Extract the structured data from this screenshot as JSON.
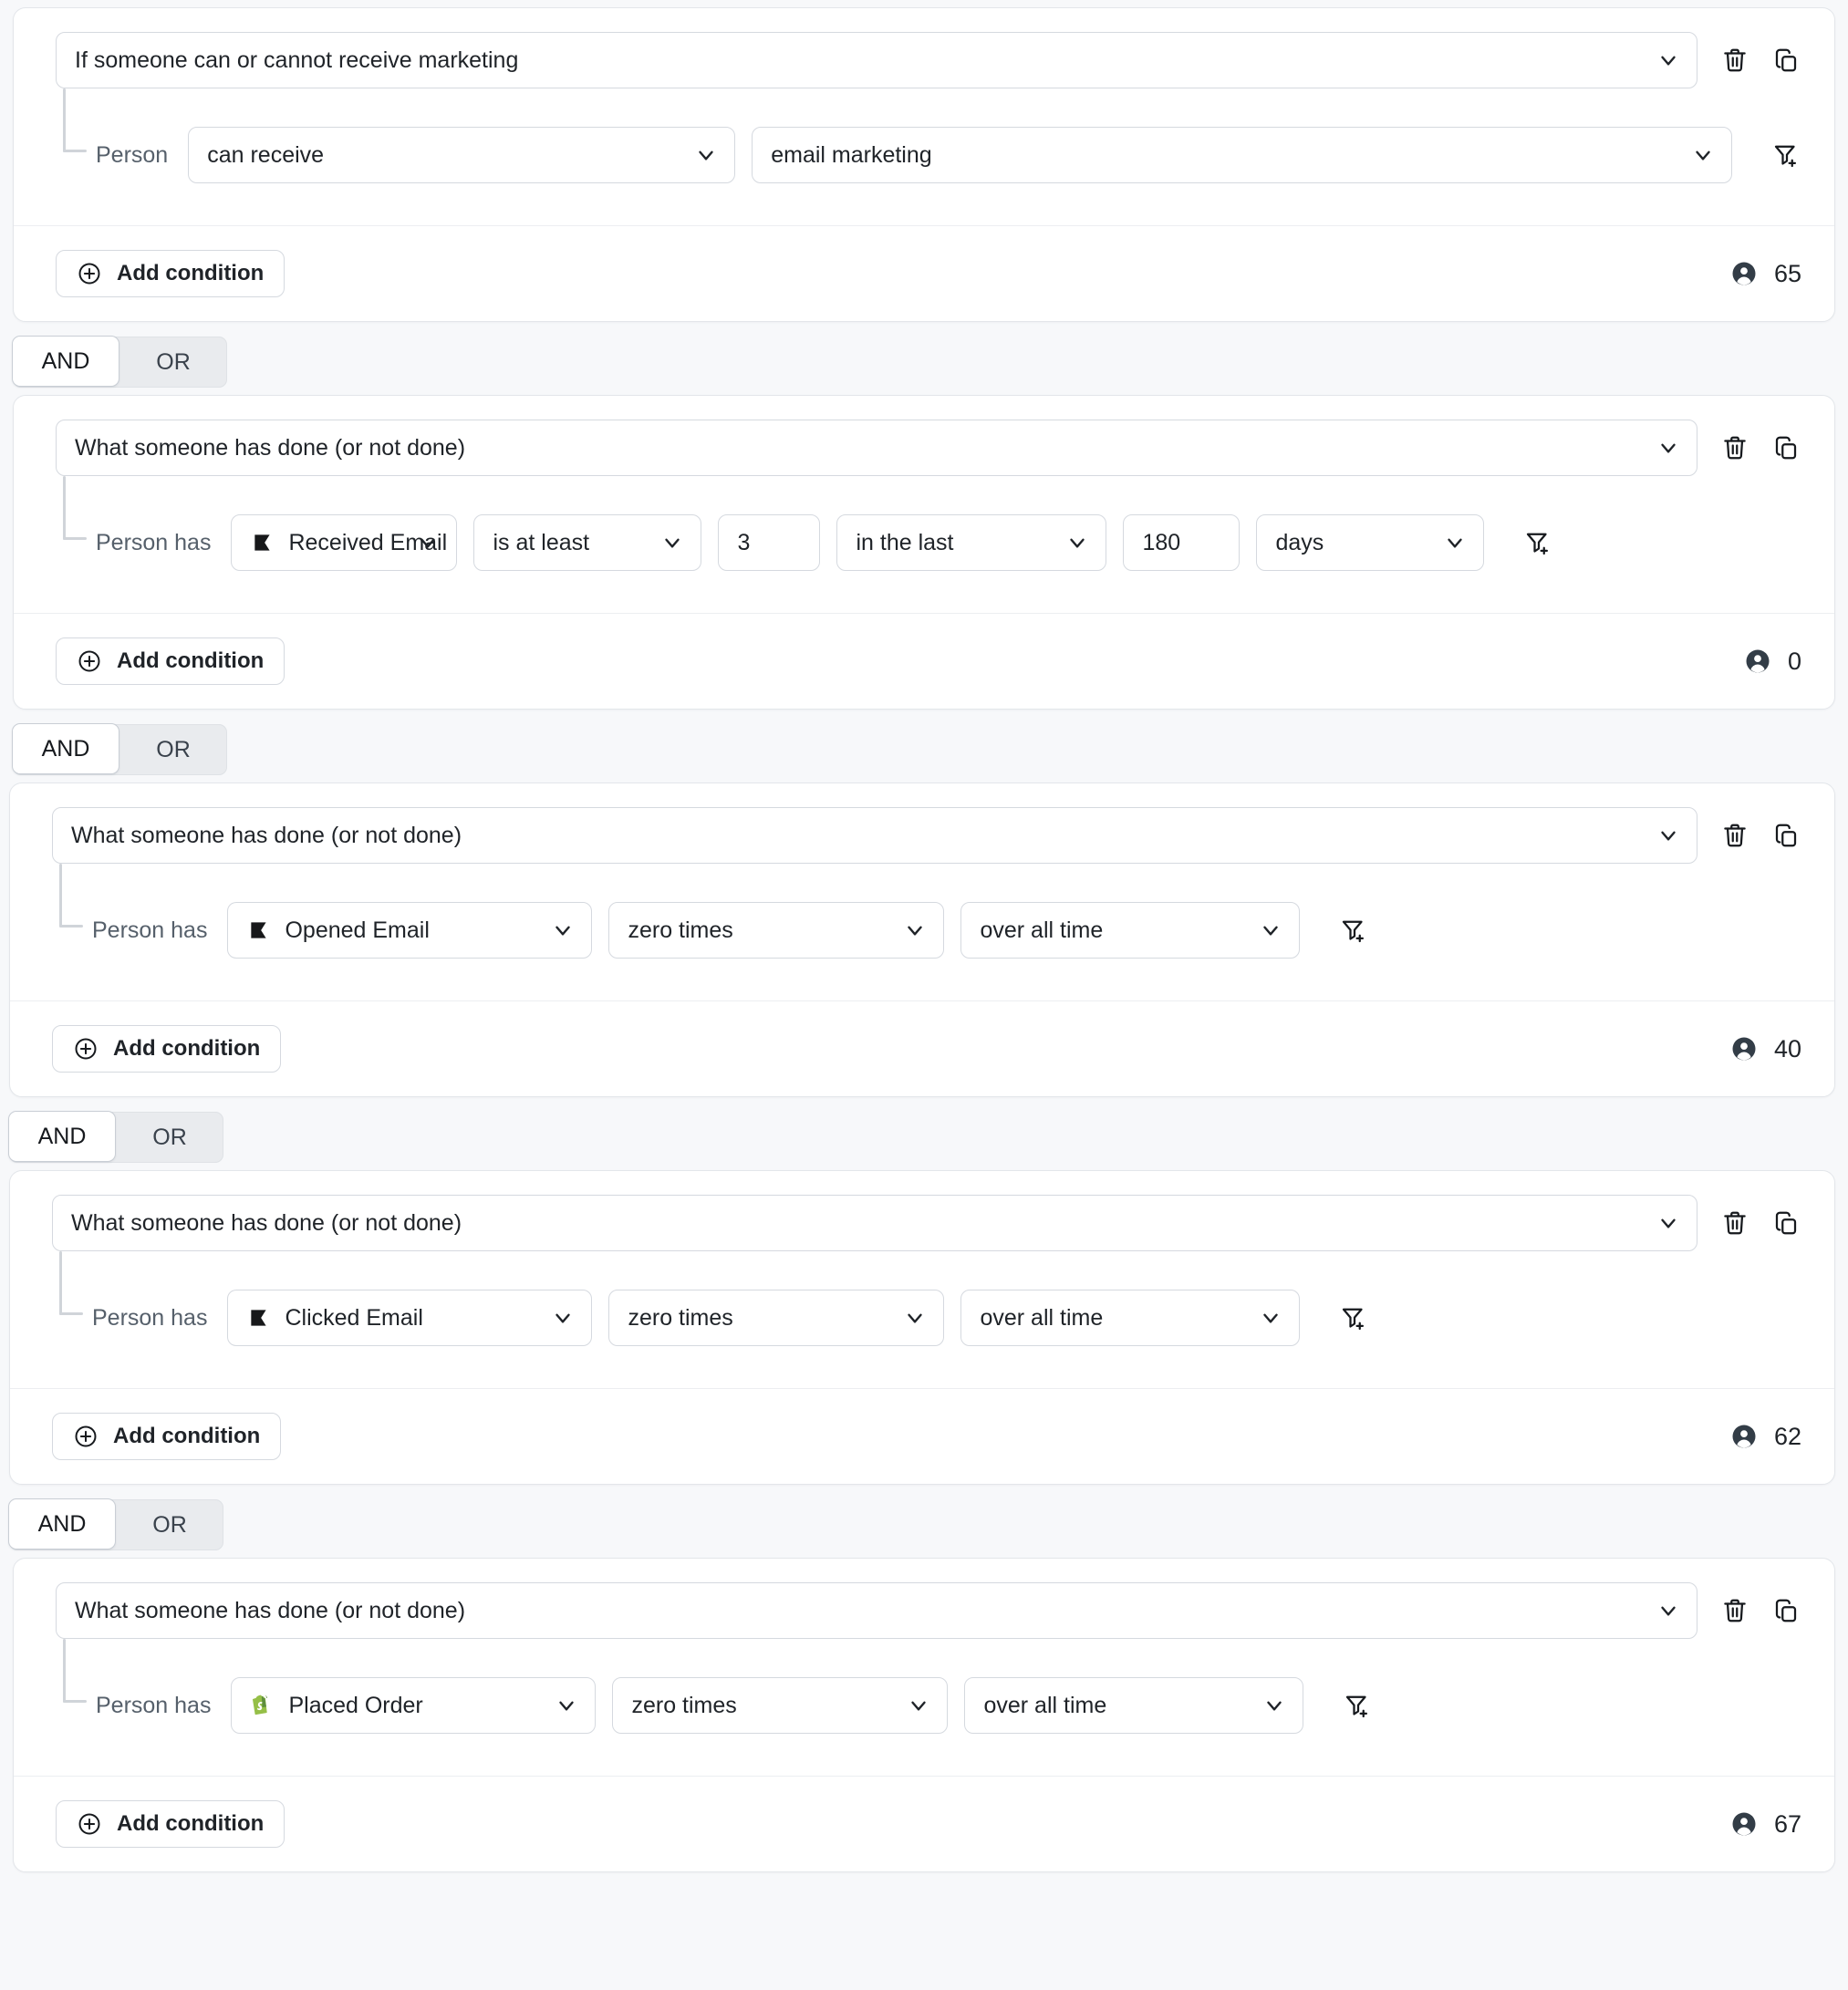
{
  "theme": {
    "page_background": "#f7f8fa",
    "card_background": "#ffffff",
    "border": "#d5d9df",
    "text": "#1f2328",
    "muted_text": "#56606b",
    "shopify_green": "#95BF47",
    "klaviyo_black": "#1a1a1a",
    "person_icon": "#333d47"
  },
  "labels": {
    "person": "Person",
    "person_has": "Person has",
    "add_condition": "Add condition",
    "and": "AND",
    "or": "OR"
  },
  "icons": {
    "trash": "trash-icon",
    "duplicate": "duplicate-icon",
    "filter_add": "filter-add-icon",
    "chevron_down": "chevron-down-icon",
    "plus_circle": "plus-circle-icon",
    "person": "person-icon",
    "klaviyo_flag": "klaviyo-flag-icon",
    "shopify_bag": "shopify-bag-icon"
  },
  "blocks": [
    {
      "id": "block-1",
      "trigger": "If someone can or cannot receive marketing",
      "sub_label": "Person",
      "fields": [
        {
          "name": "channel-permission-select",
          "type": "select",
          "value": "can receive",
          "icon": null
        },
        {
          "name": "marketing-channel-select",
          "type": "select",
          "value": "email marketing",
          "icon": null
        }
      ],
      "add_condition": "Add condition",
      "count": "65"
    },
    {
      "id": "block-2",
      "trigger": "What someone has done (or not done)",
      "sub_label": "Person has",
      "fields": [
        {
          "name": "metric-select",
          "type": "select",
          "value": "Received Email",
          "icon": "klaviyo-flag-icon"
        },
        {
          "name": "operator-select",
          "type": "select",
          "value": "is at least",
          "icon": null
        },
        {
          "name": "count-input",
          "type": "input",
          "value": "3",
          "icon": null
        },
        {
          "name": "timeframe-select",
          "type": "select",
          "value": "in the last",
          "icon": null
        },
        {
          "name": "duration-input",
          "type": "input",
          "value": "180",
          "icon": null
        },
        {
          "name": "duration-unit-select",
          "type": "select",
          "value": "days",
          "icon": null
        }
      ],
      "add_condition": "Add condition",
      "count": "0"
    },
    {
      "id": "block-3",
      "trigger": "What someone has done (or not done)",
      "sub_label": "Person has",
      "fields": [
        {
          "name": "metric-select",
          "type": "select",
          "value": "Opened Email",
          "icon": "klaviyo-flag-icon"
        },
        {
          "name": "operator-select",
          "type": "select",
          "value": "zero times",
          "icon": null
        },
        {
          "name": "timeframe-select",
          "type": "select",
          "value": "over all time",
          "icon": null
        }
      ],
      "add_condition": "Add condition",
      "count": "40"
    },
    {
      "id": "block-4",
      "trigger": "What someone has done (or not done)",
      "sub_label": "Person has",
      "fields": [
        {
          "name": "metric-select",
          "type": "select",
          "value": "Clicked Email",
          "icon": "klaviyo-flag-icon"
        },
        {
          "name": "operator-select",
          "type": "select",
          "value": "zero times",
          "icon": null
        },
        {
          "name": "timeframe-select",
          "type": "select",
          "value": "over all time",
          "icon": null
        }
      ],
      "add_condition": "Add condition",
      "count": "62"
    },
    {
      "id": "block-5",
      "trigger": "What someone has done (or not done)",
      "sub_label": "Person has",
      "fields": [
        {
          "name": "metric-select",
          "type": "select",
          "value": "Placed Order",
          "icon": "shopify-bag-icon"
        },
        {
          "name": "operator-select",
          "type": "select",
          "value": "zero times",
          "icon": null
        },
        {
          "name": "timeframe-select",
          "type": "select",
          "value": "over all time",
          "icon": null
        }
      ],
      "add_condition": "Add condition",
      "count": "67"
    }
  ],
  "connectors": [
    {
      "id": "connector-1",
      "selected": "AND",
      "and": "AND",
      "or": "OR"
    },
    {
      "id": "connector-2",
      "selected": "AND",
      "and": "AND",
      "or": "OR"
    },
    {
      "id": "connector-3",
      "selected": "AND",
      "and": "AND",
      "or": "OR"
    },
    {
      "id": "connector-4",
      "selected": "AND",
      "and": "AND",
      "or": "OR"
    }
  ]
}
